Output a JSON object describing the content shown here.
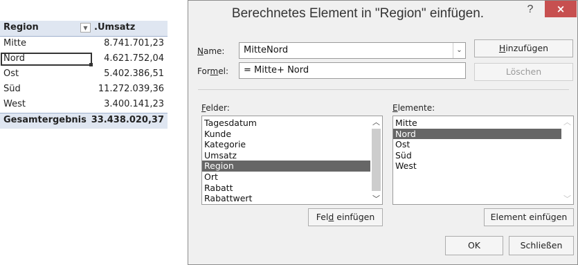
{
  "pivot": {
    "header": {
      "row_label": "Region",
      "value_label": ".Umsatz",
      "dropdown_icon": "chevron-down-icon"
    },
    "rows": [
      {
        "label": "Mitte",
        "value": "8.741.701,23"
      },
      {
        "label": "Nord",
        "value": "4.621.752,04"
      },
      {
        "label": "Ost",
        "value": "5.402.386,51"
      },
      {
        "label": "Süd",
        "value": "11.272.039,36"
      },
      {
        "label": "West",
        "value": "3.400.141,23"
      }
    ],
    "total": {
      "label": "Gesamtergebnis",
      "value": "33.438.020,37"
    },
    "selected_row_index": 1
  },
  "dialog": {
    "title": "Berechnetes Element in \"Region\" einfügen.",
    "help_label": "?",
    "close_label": "×",
    "name_label_u": "N",
    "name_label_rest": "ame:",
    "name_value": "MitteNord",
    "formula_label_pre": "For",
    "formula_label_u": "m",
    "formula_label_post": "el:",
    "formula_value": "= Mitte+ Nord",
    "add_button_u": "H",
    "add_button_rest": "inzufügen",
    "delete_button": "Löschen",
    "fields_label_u": "F",
    "fields_label_rest": "elder:",
    "fields": [
      "Tagesdatum",
      "Kunde",
      "Kategorie",
      "Umsatz",
      "Region",
      "Ort",
      "Rabatt",
      "Rabattwert"
    ],
    "fields_selected_index": 4,
    "elements_label_u": "E",
    "elements_label_rest": "lemente:",
    "elements": [
      "Mitte",
      "Nord",
      "Ost",
      "Süd",
      "West"
    ],
    "elements_selected_index": 1,
    "insert_field_pre": "Fel",
    "insert_field_u": "d",
    "insert_field_post": " einfügen",
    "insert_element_pre": "Element einfü",
    "insert_element_u": "g",
    "insert_element_post": "en",
    "ok_button": "OK",
    "close_button": "Schließen"
  }
}
